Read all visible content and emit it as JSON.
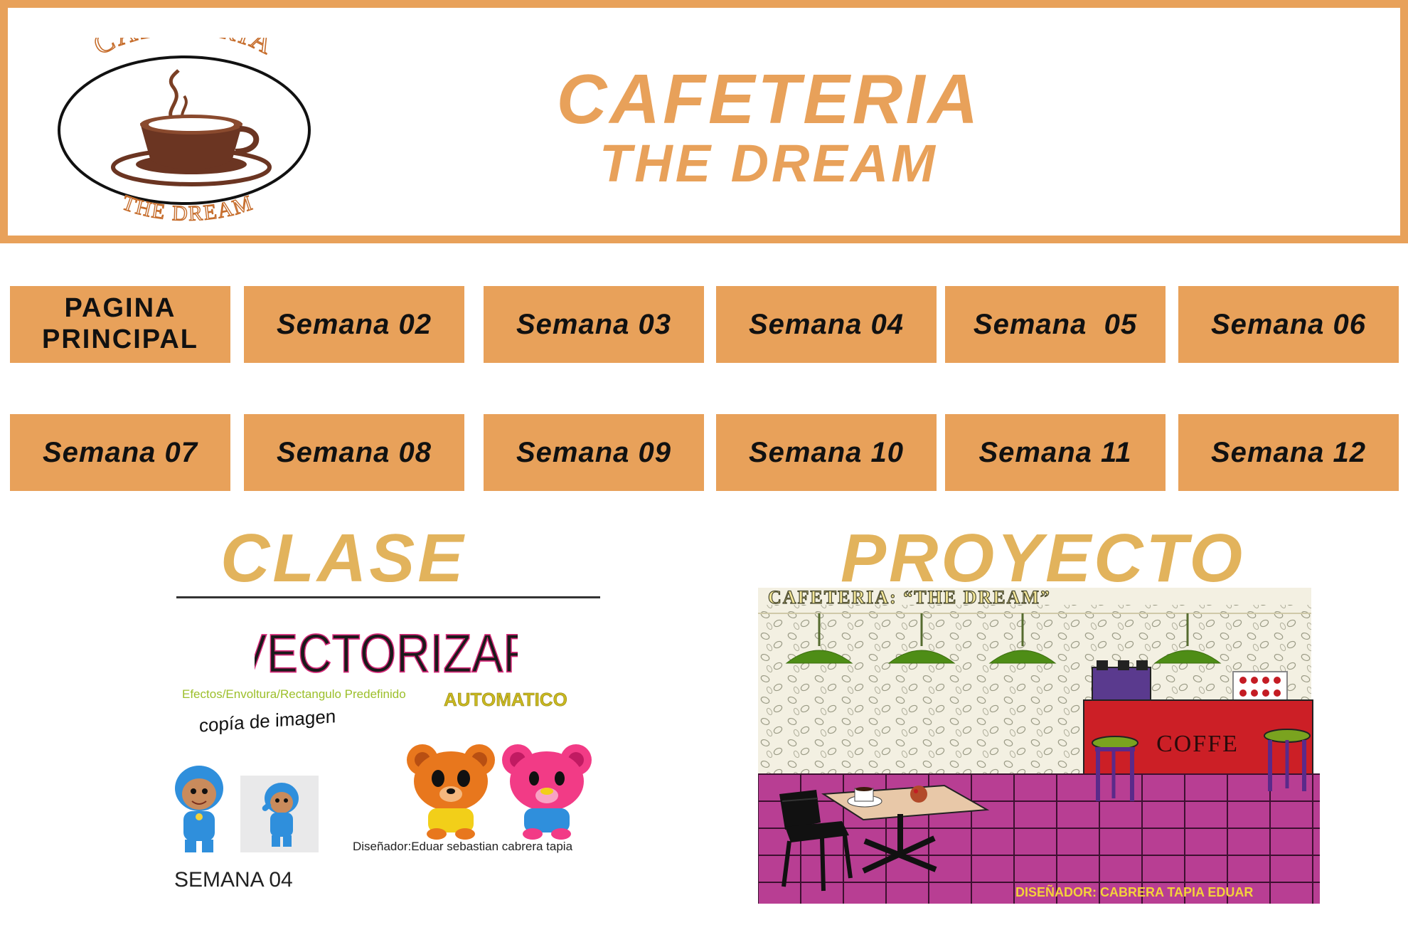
{
  "header": {
    "logo_top": "CAFETERIA",
    "logo_bottom": "THE DREAM",
    "title_line1": "CAFETERIA",
    "title_line2": "THE DREAM"
  },
  "nav": {
    "home_line1": "PAGINA",
    "home_line2": "PRINCIPAL",
    "weeks": [
      "Semana 02",
      "Semana 03",
      "Semana 04",
      "Semana  05",
      "Semana 06",
      "Semana 07",
      "Semana 08",
      "Semana 09",
      "Semana 10",
      "Semana 11",
      "Semana 12"
    ]
  },
  "clase": {
    "title": "CLASE",
    "heading": "VECTORIZAR",
    "effects_text": "Efectos/Envoltura/Rectangulo Predefinido",
    "automatic_text": "AUTOMATICO",
    "copy_text": "copía de imagen",
    "designer_text": "Diseñador:Eduar sebastian cabrera tapia",
    "week_label": "SEMANA 04"
  },
  "proyecto": {
    "title": "PROYECTO",
    "banner": "CAFETERIA: “THE DREAM”",
    "counter_sign": "COFFE",
    "designer": "DISEÑADOR: CABRERA TAPIA EDUAR"
  },
  "colors": {
    "accent": "#e8a15a",
    "section_title": "#e2b35c",
    "floor": "#b83e93",
    "counter": "#cc1f26"
  }
}
